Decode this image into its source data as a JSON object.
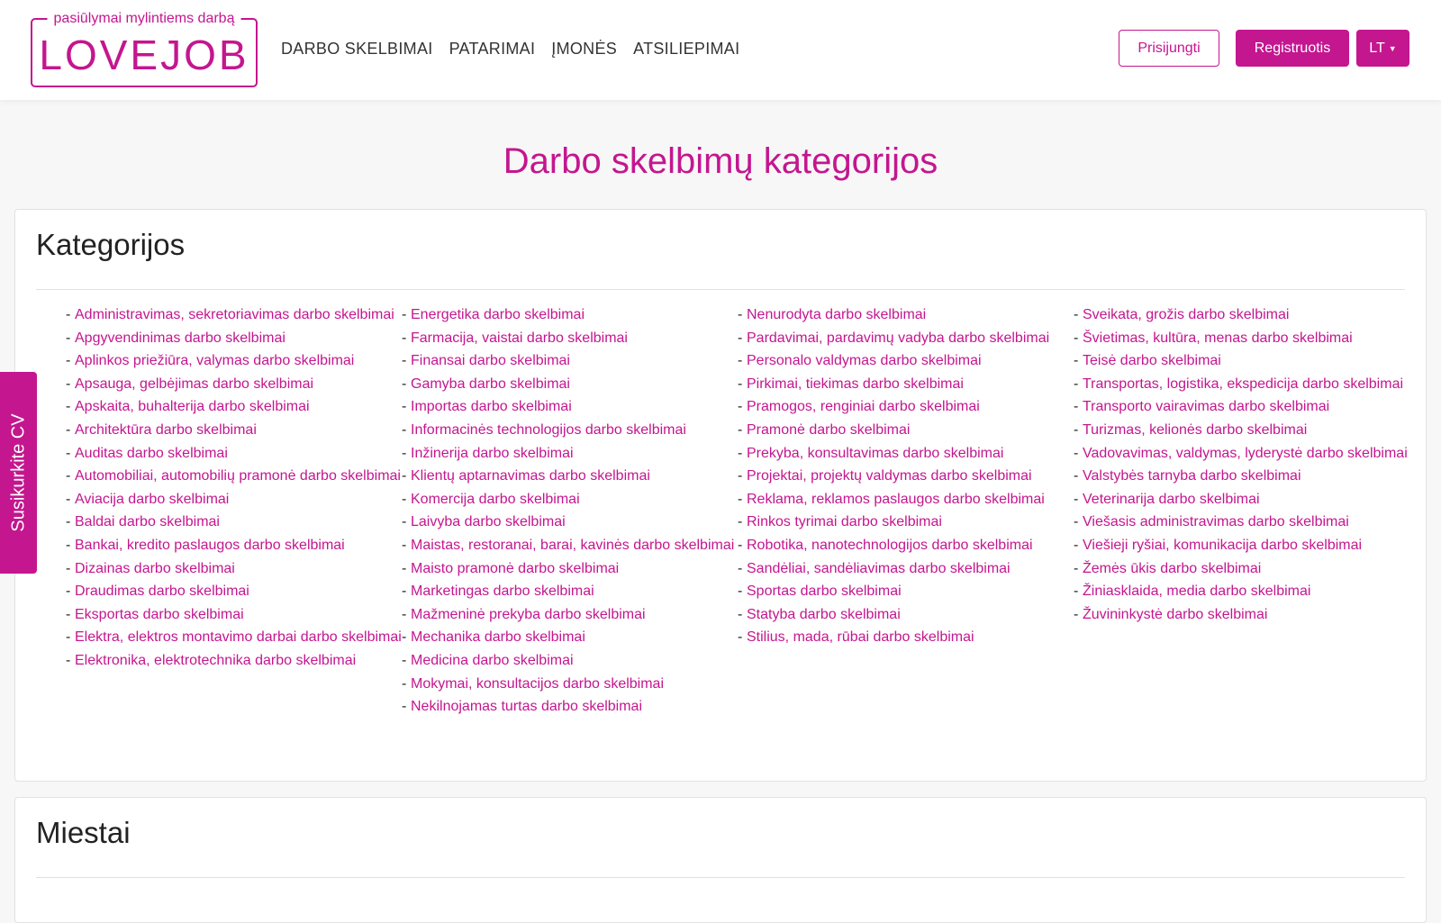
{
  "brand": {
    "tagline": "pasiūlymai mylintiems darbą",
    "wordmark": "LOVEJOB",
    "accent_color": "#c4168f"
  },
  "nav": {
    "items": [
      "DARBO SKELBIMAI",
      "PATARIMAI",
      "ĮMONĖS",
      "ATSILIEPIMAI"
    ]
  },
  "header": {
    "login_label": "Prisijungti",
    "register_label": "Registruotis",
    "language_label": "LT"
  },
  "page": {
    "title": "Darbo skelbimų kategorijos"
  },
  "categories_section": {
    "title": "Kategorijos",
    "columns": [
      [
        "Administravimas, sekretoriavimas darbo skelbimai",
        "Apgyvendinimas darbo skelbimai",
        "Aplinkos priežiūra, valymas darbo skelbimai",
        "Apsauga, gelbėjimas darbo skelbimai",
        "Apskaita, buhalterija darbo skelbimai",
        "Architektūra darbo skelbimai",
        "Auditas darbo skelbimai",
        "Automobiliai, automobilių pramonė darbo skelbimai",
        "Aviacija darbo skelbimai",
        "Baldai darbo skelbimai",
        "Bankai, kredito paslaugos darbo skelbimai",
        "Dizainas darbo skelbimai",
        "Draudimas darbo skelbimai",
        "Eksportas darbo skelbimai",
        "Elektra, elektros montavimo darbai darbo skelbimai",
        "Elektronika, elektrotechnika darbo skelbimai"
      ],
      [
        "Energetika darbo skelbimai",
        "Farmacija, vaistai darbo skelbimai",
        "Finansai darbo skelbimai",
        "Gamyba darbo skelbimai",
        "Importas darbo skelbimai",
        "Informacinės technologijos darbo skelbimai",
        "Inžinerija darbo skelbimai",
        "Klientų aptarnavimas darbo skelbimai",
        "Komercija darbo skelbimai",
        "Laivyba darbo skelbimai",
        "Maistas, restoranai, barai, kavinės darbo skelbimai",
        "Maisto pramonė darbo skelbimai",
        "Marketingas darbo skelbimai",
        "Mažmeninė prekyba darbo skelbimai",
        "Mechanika darbo skelbimai",
        "Medicina darbo skelbimai",
        "Mokymai, konsultacijos darbo skelbimai",
        "Nekilnojamas turtas darbo skelbimai"
      ],
      [
        "Nenurodyta darbo skelbimai",
        "Pardavimai, pardavimų vadyba darbo skelbimai",
        "Personalo valdymas darbo skelbimai",
        "Pirkimai, tiekimas darbo skelbimai",
        "Pramogos, renginiai darbo skelbimai",
        "Pramonė darbo skelbimai",
        "Prekyba, konsultavimas darbo skelbimai",
        "Projektai, projektų valdymas darbo skelbimai",
        "Reklama, reklamos paslaugos darbo skelbimai",
        "Rinkos tyrimai darbo skelbimai",
        "Robotika, nanotechnologijos darbo skelbimai",
        "Sandėliai, sandėliavimas darbo skelbimai",
        "Sportas darbo skelbimai",
        "Statyba darbo skelbimai",
        "Stilius, mada, rūbai darbo skelbimai"
      ],
      [
        "Sveikata, grožis darbo skelbimai",
        "Švietimas, kultūra, menas darbo skelbimai",
        "Teisė darbo skelbimai",
        "Transportas, logistika, ekspedicija darbo skelbimai",
        "Transporto vairavimas darbo skelbimai",
        "Turizmas, kelionės darbo skelbimai",
        "Vadovavimas, valdymas, lyderystė darbo skelbimai",
        "Valstybės tarnyba darbo skelbimai",
        "Veterinarija darbo skelbimai",
        "Viešasis administravimas darbo skelbimai",
        "Viešieji ryšiai, komunikacija darbo skelbimai",
        "Žemės ūkis darbo skelbimai",
        "Žiniasklaida, media darbo skelbimai",
        "Žuvininkystė darbo skelbimai"
      ]
    ]
  },
  "cities_section": {
    "title": "Miestai"
  },
  "side_tab": {
    "label": "Susikurkite CV"
  }
}
